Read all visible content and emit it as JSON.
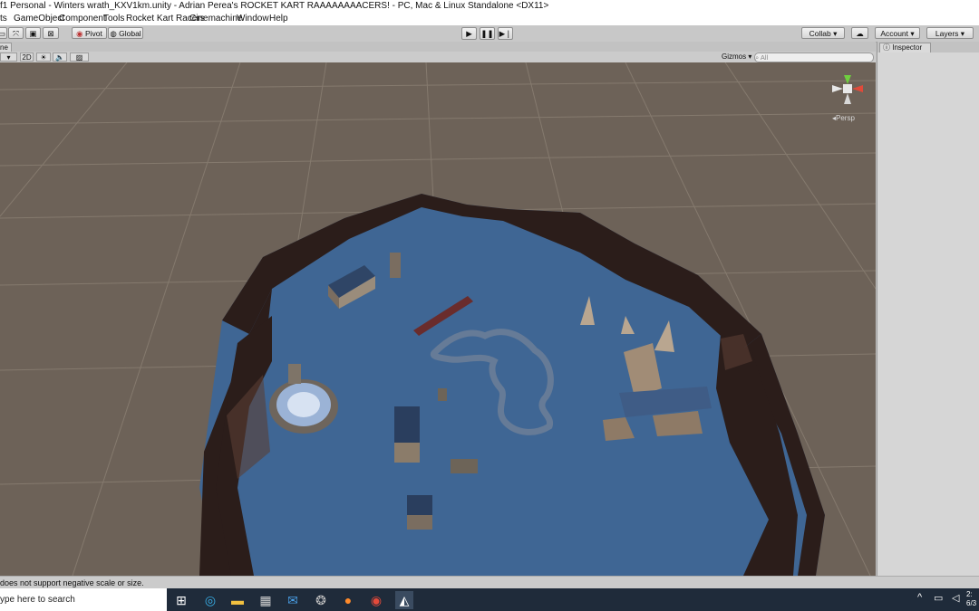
{
  "window": {
    "title": "f1 Personal - Winters wrath_KXV1km.unity - Adrian Perea's ROCKET KART RAAAAAAAACERS! - PC, Mac & Linux Standalone <DX11>"
  },
  "menu": {
    "items": [
      "ts",
      "GameObject",
      "Component",
      "Tools",
      "Rocket Kart Racers",
      "Cinemachine",
      "Window",
      "Help"
    ]
  },
  "toolbar": {
    "pivot_label": "Pivot",
    "global_label": "Global",
    "collab_label": "Collab ▾",
    "account_label": "Account",
    "layers_label": "Layers"
  },
  "scene": {
    "tab_label": "ne",
    "mode_2d_label": "2D",
    "gizmos_label": "Gizmos ▾",
    "search_placeholder": "All",
    "persp_label": "Persp"
  },
  "inspector": {
    "tab_label": "Inspector"
  },
  "status": {
    "message": "does not support negative scale or size."
  },
  "taskbar": {
    "search_text": "ype here to search",
    "icons": [
      "task-view-icon",
      "edge-icon",
      "file-explorer-icon",
      "store-icon",
      "mail-icon",
      "photos-icon",
      "firefox-icon",
      "chrome-icon",
      "unity-icon"
    ],
    "clock_time": "2:",
    "clock_date": "6/3"
  },
  "colors": {
    "viewport_bg": "#6d6258",
    "water": "#3f6694",
    "cliff": "#2d1f1b",
    "taskbar": "#1f2b3a"
  }
}
